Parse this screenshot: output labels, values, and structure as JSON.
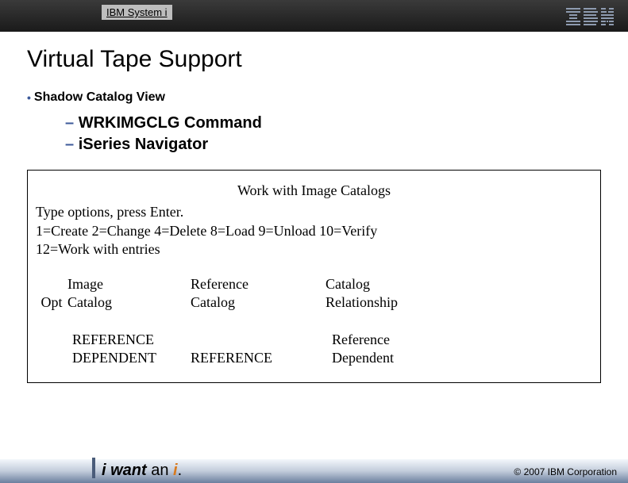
{
  "header": {
    "product_line": "IBM System i",
    "logo_alt": "IBM"
  },
  "slide": {
    "title": "Virtual Tape Support",
    "bullet_main": "Shadow Catalog View",
    "sub_bullets": {
      "a": "WRKIMGCLG Command",
      "b": "iSeries Navigator"
    }
  },
  "screen": {
    "title": "Work with Image Catalogs",
    "instruction_line": "Type options, press Enter.",
    "options_line1": "1=Create  2=Change  4=Delete  8=Load  9=Unload  10=Verify",
    "options_line2": "12=Work with entries",
    "col_headers": {
      "opt": "Opt",
      "image_catalog_l1": "Image",
      "image_catalog_l2": "Catalog",
      "ref_catalog_l1": "Reference",
      "ref_catalog_l2": "Catalog",
      "cat_rel_l1": "Catalog",
      "cat_rel_l2": "Relationship"
    },
    "rows": {
      "r1_image": "REFERENCE",
      "r1_ref": "",
      "r1_rel": "Reference",
      "r2_image": "DEPENDENT",
      "r2_ref": "REFERENCE",
      "r2_rel": "Dependent"
    }
  },
  "footer": {
    "tagline_bold": "i want",
    "tagline_plain": " an ",
    "tagline_i": "i",
    "tagline_dot": ".",
    "copyright": "© 2007 IBM Corporation"
  }
}
